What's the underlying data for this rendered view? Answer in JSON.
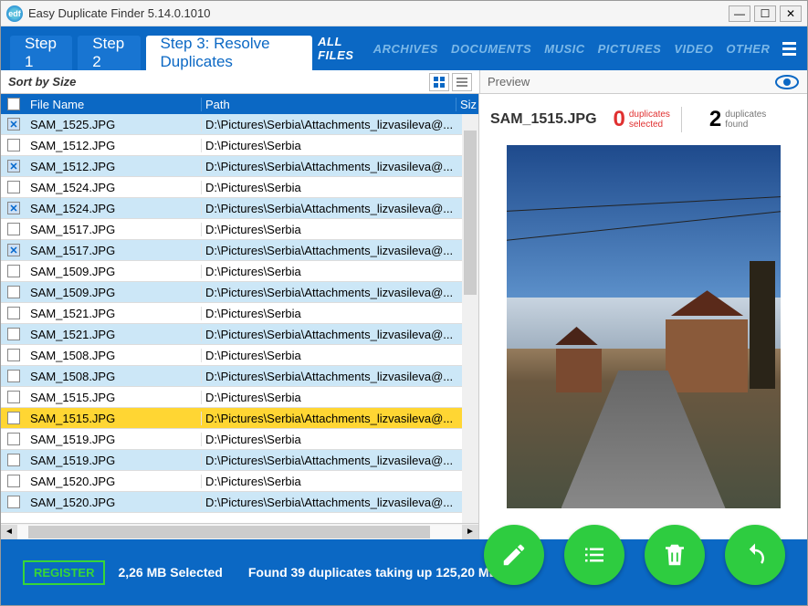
{
  "window": {
    "title": "Easy Duplicate Finder 5.14.0.1010",
    "logo_text": "edf"
  },
  "tabs": {
    "step1": "Step 1",
    "step2": "Step 2",
    "step3": "Step 3: Resolve Duplicates"
  },
  "filters": [
    "ALL FILES",
    "ARCHIVES",
    "DOCUMENTS",
    "MUSIC",
    "PICTURES",
    "VIDEO",
    "OTHER"
  ],
  "sort_label": "Sort by Size",
  "preview_label": "Preview",
  "columns": {
    "name": "File Name",
    "path": "Path",
    "size": "Siz"
  },
  "paths": {
    "short": "D:\\Pictures\\Serbia",
    "long": "D:\\Pictures\\Serbia\\Attachments_lizvasileva@..."
  },
  "rows": [
    {
      "name": "SAM_1525.JPG",
      "dup": true,
      "checked": true,
      "sel": false
    },
    {
      "name": "SAM_1512.JPG",
      "dup": false,
      "checked": false,
      "sel": false
    },
    {
      "name": "SAM_1512.JPG",
      "dup": true,
      "checked": true,
      "sel": false
    },
    {
      "name": "SAM_1524.JPG",
      "dup": false,
      "checked": false,
      "sel": false
    },
    {
      "name": "SAM_1524.JPG",
      "dup": true,
      "checked": true,
      "sel": false
    },
    {
      "name": "SAM_1517.JPG",
      "dup": false,
      "checked": false,
      "sel": false
    },
    {
      "name": "SAM_1517.JPG",
      "dup": true,
      "checked": true,
      "sel": false
    },
    {
      "name": "SAM_1509.JPG",
      "dup": false,
      "checked": false,
      "sel": false
    },
    {
      "name": "SAM_1509.JPG",
      "dup": true,
      "checked": false,
      "sel": false
    },
    {
      "name": "SAM_1521.JPG",
      "dup": false,
      "checked": false,
      "sel": false
    },
    {
      "name": "SAM_1521.JPG",
      "dup": true,
      "checked": false,
      "sel": false
    },
    {
      "name": "SAM_1508.JPG",
      "dup": false,
      "checked": false,
      "sel": false
    },
    {
      "name": "SAM_1508.JPG",
      "dup": true,
      "checked": false,
      "sel": false
    },
    {
      "name": "SAM_1515.JPG",
      "dup": false,
      "checked": false,
      "sel": false
    },
    {
      "name": "SAM_1515.JPG",
      "dup": true,
      "checked": false,
      "sel": true
    },
    {
      "name": "SAM_1519.JPG",
      "dup": false,
      "checked": false,
      "sel": false
    },
    {
      "name": "SAM_1519.JPG",
      "dup": true,
      "checked": false,
      "sel": false
    },
    {
      "name": "SAM_1520.JPG",
      "dup": false,
      "checked": false,
      "sel": false
    },
    {
      "name": "SAM_1520.JPG",
      "dup": true,
      "checked": false,
      "sel": false
    }
  ],
  "preview": {
    "filename": "SAM_1515.JPG",
    "selected_count": "0",
    "selected_label": "duplicates\nselected",
    "found_count": "2",
    "found_label": "duplicates\nfound"
  },
  "footer": {
    "register": "REGISTER",
    "selected": "2,26 MB Selected",
    "found": "Found 39 duplicates taking up 125,20 MB"
  }
}
